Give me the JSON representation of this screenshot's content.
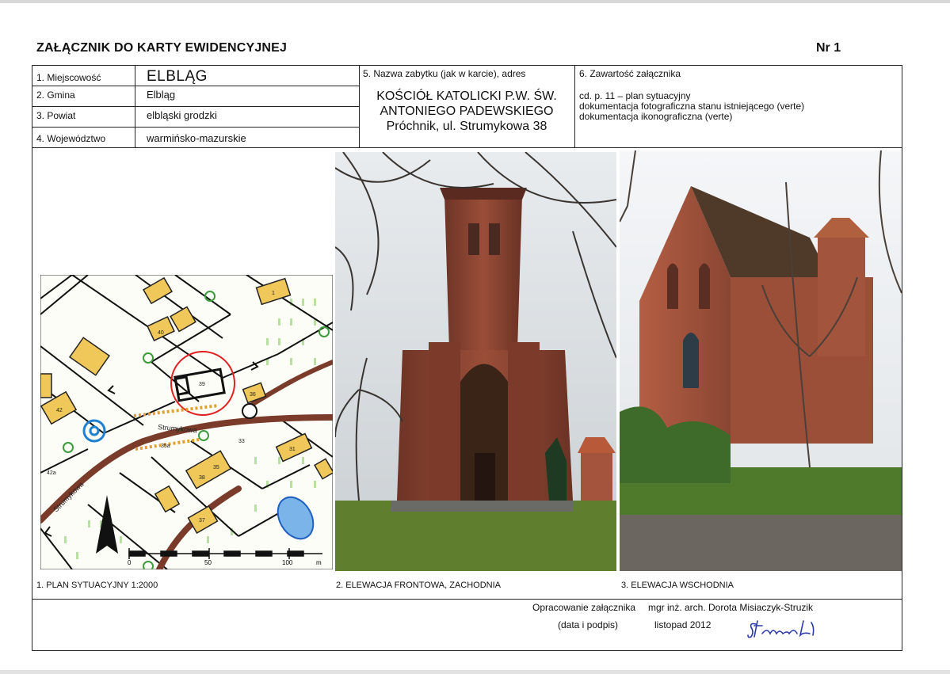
{
  "header": {
    "title": "ZAŁĄCZNIK DO KARTY EWIDENCYJNEJ",
    "nr": "Nr 1"
  },
  "fields": [
    {
      "label": "1. Miejscowość",
      "value": "ELBLĄG"
    },
    {
      "label": "2. Gmina",
      "value": "Elbląg"
    },
    {
      "label": "3. Powiat",
      "value": "elbląski grodzki"
    },
    {
      "label": "4. Województwo",
      "value": "warmińsko-mazurskie"
    }
  ],
  "monument": {
    "label": "5. Nazwa zabytku (jak w karcie), adres",
    "name_lines": [
      "KOŚCIÓŁ KATOLICKI P.W. ŚW.",
      "ANTONIEGO PADEWSKIEGO",
      "Próchnik, ul. Strumykowa 38"
    ]
  },
  "contents": {
    "label": "6. Zawartość załącznika",
    "lines": [
      "cd. p. 11 – plan sytuacyjny",
      "dokumentacja fotograficzna stanu istniejącego (verte)",
      "dokumentacja ikonograficzna (verte)"
    ]
  },
  "map": {
    "street_name": "Strumykowa",
    "street_name_2": "Strumykowa",
    "labels": [
      "1",
      "40",
      "42",
      "38",
      "39",
      "33",
      "31",
      "35",
      "35a",
      "37",
      "42a",
      "36"
    ],
    "scale_labels": [
      "0",
      "50",
      "100",
      "m"
    ]
  },
  "captions": {
    "plan": "1. PLAN SYTUACYJNY 1:2000",
    "front": "2. ELEWACJA FRONTOWA, ZACHODNIA",
    "east": "3. ELEWACJA WSCHODNIA"
  },
  "footer": {
    "prepared_label": "Opracowanie załącznika",
    "author": "mgr inż. arch. Dorota Misiaczyk-Struzik",
    "date_label": "(data i podpis)",
    "date": "listopad 2012"
  },
  "colors": {
    "road": "#7a3b2a",
    "building": "#f0c85a",
    "highlight": "#e02020",
    "water": "#7ab4e8",
    "brick": "#8e4a36",
    "grass": "#6e8e3a"
  }
}
